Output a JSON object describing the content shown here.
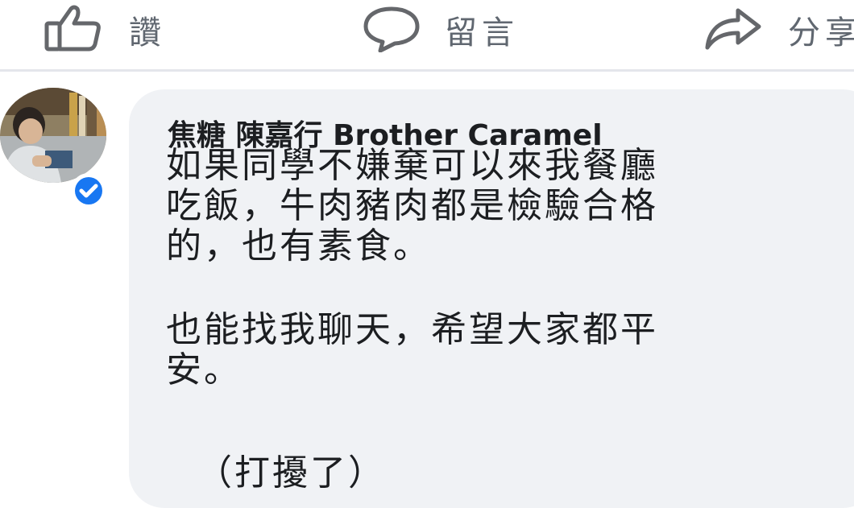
{
  "actions": {
    "like_label": "讚",
    "comment_label": "留言",
    "share_label": "分享"
  },
  "comment": {
    "author": "焦糖 陳嘉行 Brother Caramel",
    "verified": true,
    "lines": [
      "如果同學不嫌棄可以來我餐廳",
      "吃飯，牛肉豬肉都是檢驗合格",
      "的，也有素食。",
      "也能找我聊天，希望大家都平",
      "安。"
    ],
    "closing": "（打擾了）"
  },
  "colors": {
    "bubble": "#f0f2f5",
    "icon": "#65676b",
    "verified_badge": "#1877f2"
  },
  "icons": {
    "like": "thumbs-up-icon",
    "comment": "speech-bubble-icon",
    "share": "share-arrow-icon",
    "verified": "verified-badge-icon"
  }
}
